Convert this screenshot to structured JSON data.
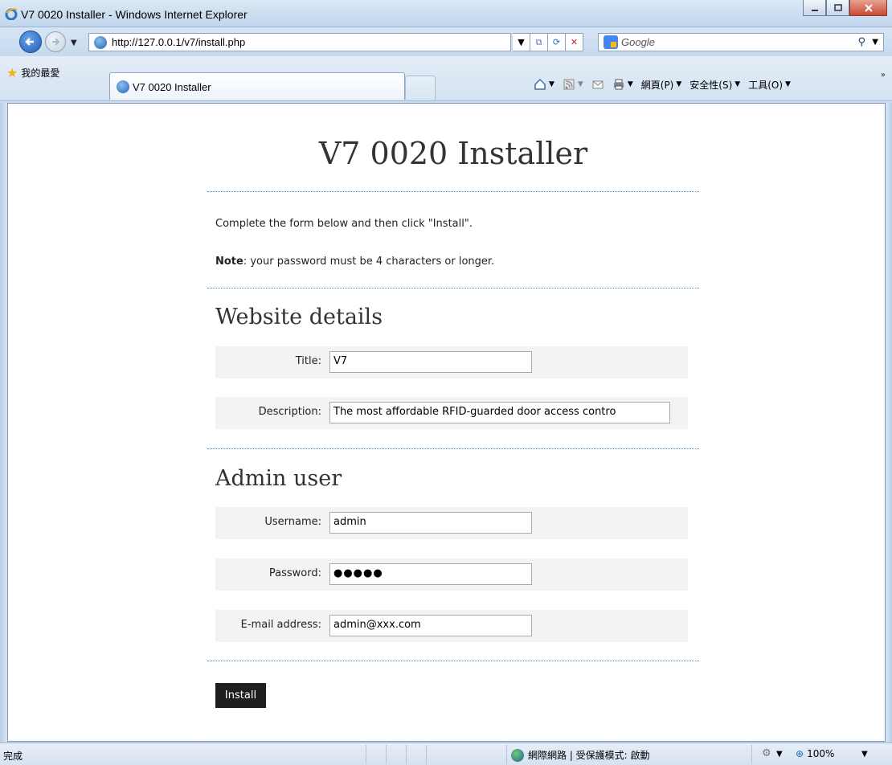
{
  "window": {
    "title": "V7 0020 Installer - Windows Internet Explorer"
  },
  "address_bar": {
    "url": "http://127.0.0.1/v7/install.php",
    "search_placeholder": "Google"
  },
  "favorites": {
    "label": "我的最愛"
  },
  "tab": {
    "label": "V7 0020 Installer"
  },
  "command_bar": {
    "page_label": "網頁(P)",
    "safety_label": "安全性(S)",
    "tools_label": "工具(O)"
  },
  "page": {
    "title": "V7 0020 Installer",
    "intro": "Complete the form below and then click \"Install\".",
    "note_label": "Note",
    "note_text": ": your password must be 4 characters or longer.",
    "website_section": "Website details",
    "admin_section": "Admin user",
    "fields": {
      "title_label": "Title:",
      "title_value": "V7",
      "description_label": "Description:",
      "description_value": "The most affordable RFID-guarded door access contro",
      "username_label": "Username:",
      "username_value": "admin",
      "password_label": "Password:",
      "password_value": "●●●●●",
      "email_label": "E-mail address:",
      "email_value": "admin@xxx.com"
    },
    "install_button": "Install"
  },
  "status_bar": {
    "status": "完成",
    "zone": "網際網路 | 受保護模式: 啟動",
    "zoom": "100%"
  },
  "colors": {
    "accent_rule": "#4e92c8",
    "button_bg": "#1f1f1f",
    "row_bg": "#f3f3f3"
  }
}
